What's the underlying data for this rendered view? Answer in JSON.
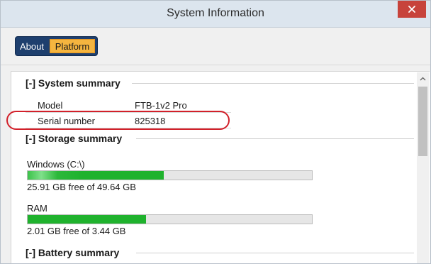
{
  "window": {
    "title": "System Information"
  },
  "tabs": [
    {
      "label": "About",
      "selected": false
    },
    {
      "label": "Platform",
      "selected": true
    }
  ],
  "system_summary": {
    "header": "[-] System summary",
    "rows": [
      {
        "label": "Model",
        "value": "FTB-1v2 Pro"
      },
      {
        "label": "Serial number",
        "value": "825318"
      }
    ]
  },
  "storage_summary": {
    "header": "[-] Storage summary",
    "items": [
      {
        "label": "Windows (C:\\)",
        "usage_text": "25.91 GB free of 49.64 GB",
        "used_fraction": 0.478
      },
      {
        "label": "RAM",
        "usage_text": "2.01 GB free of 3.44 GB",
        "used_fraction": 0.416
      }
    ]
  },
  "battery_summary": {
    "header": "[-] Battery summary"
  },
  "colors": {
    "bar_fill": "#1fb22d",
    "highlight": "#d2202a",
    "selected_tab": "#f5b53f",
    "tab_dark": "#1e3f6e"
  },
  "icons": {
    "close": "close-icon",
    "scroll_up": "chevron-up-icon"
  }
}
